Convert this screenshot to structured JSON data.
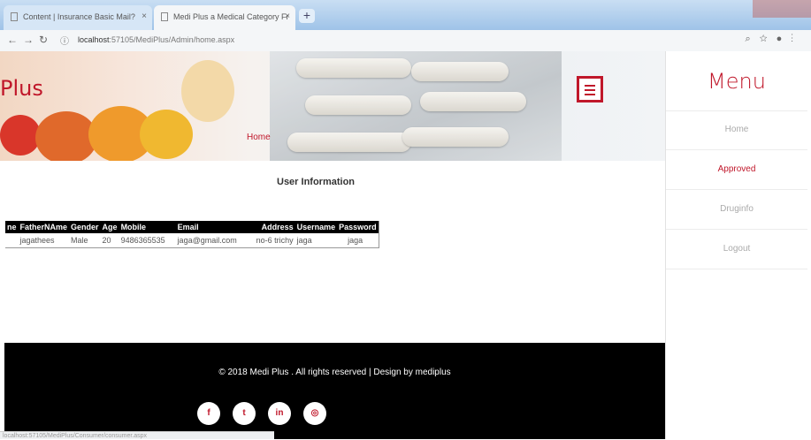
{
  "browser": {
    "tabs": [
      {
        "title": "Content | Insurance Basic Mail?"
      },
      {
        "title": "Medi Plus a Medical Category Fr"
      }
    ],
    "url_host": "localhost",
    "url_path": ":57105/MediPlus/Admin/home.aspx",
    "status_text": "localhost:57105/MediPlus/Consumer/consumer.aspx"
  },
  "hero": {
    "brand": "Plus",
    "home_link": "Home"
  },
  "main": {
    "section_title": "User Information",
    "table": {
      "headers": [
        "ne",
        "FatherNAme",
        "Gender",
        "Age",
        "Mobile",
        "Email",
        "Address",
        "Username",
        "Password"
      ],
      "rows": [
        [
          "",
          "jagathees",
          "Male",
          "20",
          "9486365535",
          "jaga@gmail.com",
          "no-6 trichy",
          "jaga",
          "jaga"
        ]
      ]
    }
  },
  "footer": {
    "copyright": "© 2018 Medi Plus . All rights reserved | Design by mediplus",
    "social": [
      {
        "icon": "facebook-icon",
        "glyph": "f"
      },
      {
        "icon": "twitter-icon",
        "glyph": "t"
      },
      {
        "icon": "linkedin-icon",
        "glyph": "in"
      },
      {
        "icon": "instagram-icon",
        "glyph": "◎"
      }
    ]
  },
  "sidebar": {
    "title": "Menu",
    "items": [
      {
        "label": "Home"
      },
      {
        "label": "Approved"
      },
      {
        "label": "Druginfo"
      },
      {
        "label": "Logout"
      }
    ]
  },
  "colors": {
    "brand": "#c0172a",
    "footer_bg": "#000000"
  }
}
